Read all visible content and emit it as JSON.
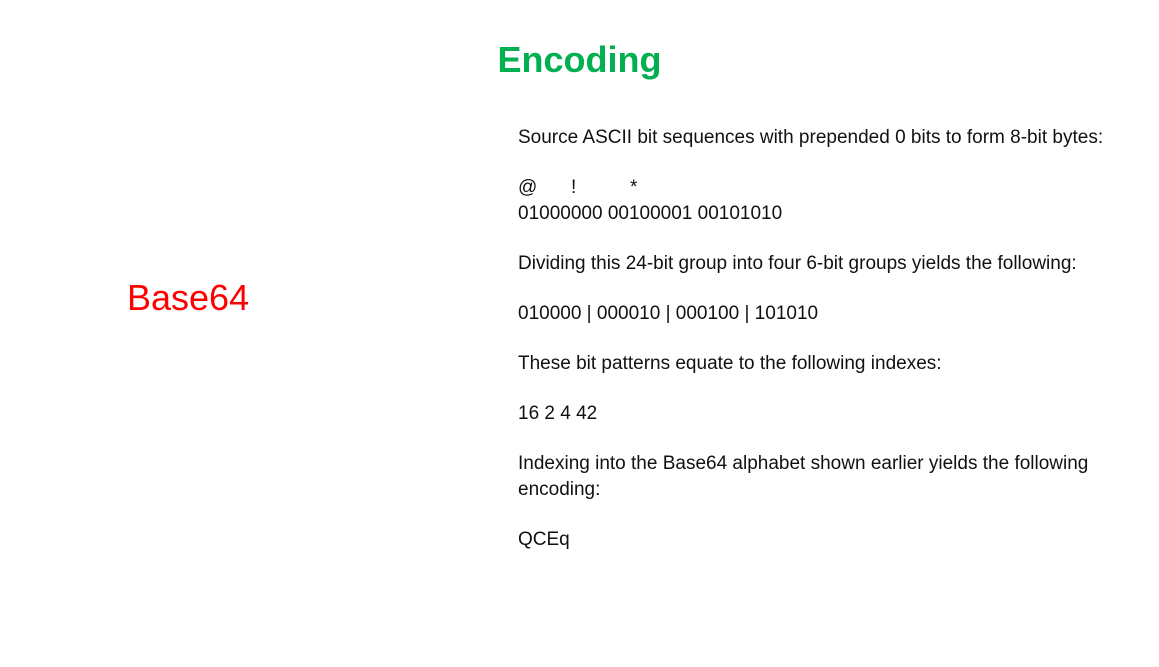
{
  "title": "Encoding",
  "side_label": "Base64",
  "colors": {
    "title": "#00b050",
    "side_label": "#ff0000",
    "body_text": "#111111",
    "background": "#ffffff"
  },
  "body": {
    "intro": "Source ASCII bit sequences with prepended 0 bits to form 8-bit bytes:",
    "source_chars": [
      "@",
      "!",
      "*"
    ],
    "source_bits": "01000000 00100001 00101010",
    "divide_text": "Dividing this 24-bit group into four 6-bit groups yields the following:",
    "six_bit_groups": "010000 | 000010 | 000100 | 101010",
    "indexes_text": "These bit patterns equate to the following indexes:",
    "indexes": "16 2 4 42",
    "alphabet_text": "Indexing into the Base64 alphabet shown earlier yields the following encoding:",
    "result": "QCEq"
  }
}
